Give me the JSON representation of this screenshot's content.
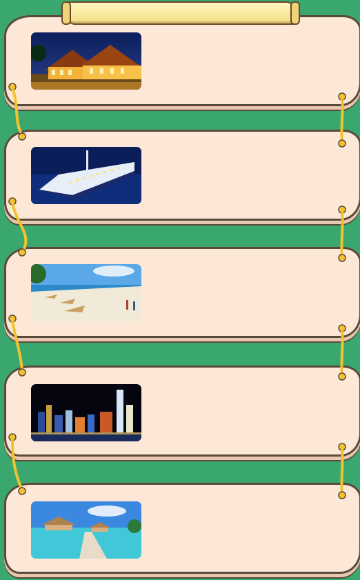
{
  "cards": [
    {
      "scene": "thai-temple-night",
      "icon": "temple-photo"
    },
    {
      "scene": "cruise-ship-night",
      "icon": "cruise-photo"
    },
    {
      "scene": "sandy-beach",
      "icon": "beach-photo"
    },
    {
      "scene": "city-skyline-night",
      "icon": "skyline-photo"
    },
    {
      "scene": "overwater-bungalows",
      "icon": "bungalow-photo"
    }
  ],
  "colors": {
    "background": "#3aa86e",
    "card": "#fde8d8",
    "outline": "#5a4a3a",
    "rope": "#f2c230"
  }
}
